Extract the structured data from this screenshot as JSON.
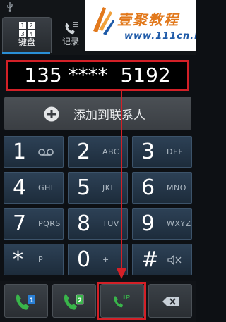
{
  "tabs": [
    {
      "label": "键盘",
      "icon": "keypad-icon",
      "active": true
    },
    {
      "label": "记录",
      "icon": "call-log-icon",
      "active": false
    }
  ],
  "keypad_tab_digits": [
    "1",
    "2",
    "3",
    "4"
  ],
  "watermark": {
    "title": "壹聚教程",
    "url": "www.111cn.Net"
  },
  "dialed_number": "135 ****  5192",
  "add_contact": {
    "label": "添加到联系人",
    "icon": "plus-icon"
  },
  "keys": [
    {
      "digit": "1",
      "letters": "",
      "icon": "voicemail-icon"
    },
    {
      "digit": "2",
      "letters": "ABC"
    },
    {
      "digit": "3",
      "letters": "DEF"
    },
    {
      "digit": "4",
      "letters": "GHI"
    },
    {
      "digit": "5",
      "letters": "JKL"
    },
    {
      "digit": "6",
      "letters": "MNO"
    },
    {
      "digit": "7",
      "letters": "PQRS"
    },
    {
      "digit": "8",
      "letters": "TUV"
    },
    {
      "digit": "9",
      "letters": "WXYZ"
    },
    {
      "digit": "*",
      "letters": "P"
    },
    {
      "digit": "0",
      "letters": "+"
    },
    {
      "digit": "#",
      "letters": "",
      "icon": "mute-icon"
    }
  ],
  "bottom_buttons": [
    {
      "name": "call-sim1-button",
      "icon": "phone-icon",
      "badge": "1"
    },
    {
      "name": "call-sim2-button",
      "icon": "phone-icon",
      "badge": "2"
    },
    {
      "name": "ip-call-button",
      "icon": "phone-icon",
      "badge": "IP"
    },
    {
      "name": "backspace-button",
      "icon": "backspace-icon"
    }
  ],
  "colors": {
    "highlight_red": "#d32027",
    "call_green": "#39b54a",
    "sim1_blue": "#2a7fd4",
    "sim2_green": "#39b54a",
    "accent_blue": "#2a8fd6",
    "watermark_orange": "#e2791c"
  }
}
